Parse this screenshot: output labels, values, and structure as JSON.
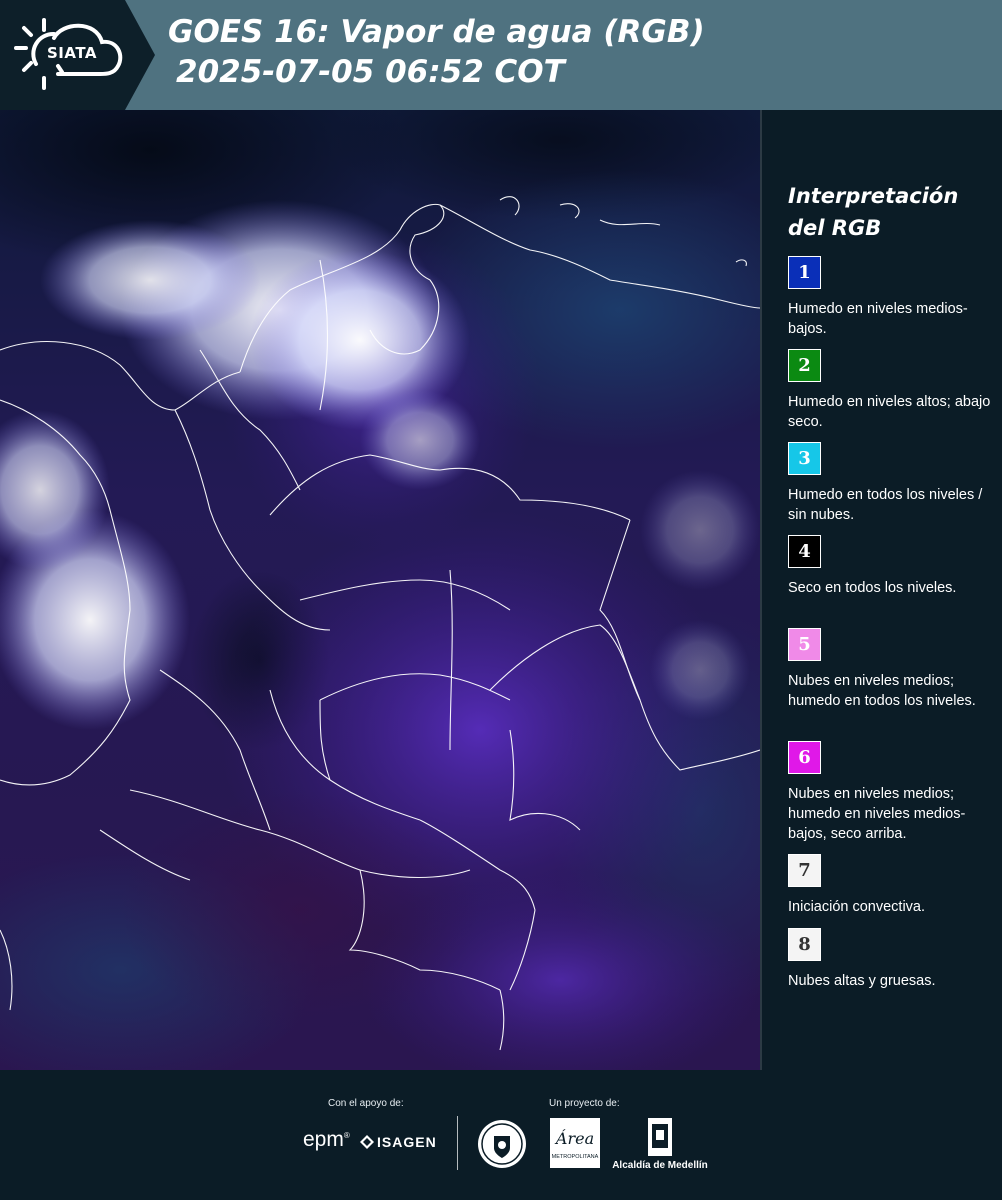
{
  "header": {
    "logo_text": "SIATA",
    "title_line1": "GOES 16: Vapor de agua (RGB)",
    "title_line2": "2025-07-05 06:52 COT"
  },
  "map": {
    "description_color": "#1a1640"
  },
  "legend": {
    "title": "Interpretación del RGB",
    "items": [
      {
        "number": "1",
        "color": "#0a2fb8",
        "text_color": "#ffffff",
        "description": "Humedo en niveles medios-bajos."
      },
      {
        "number": "2",
        "color": "#0b8a12",
        "text_color": "#ffffff",
        "description": "Humedo en niveles altos; abajo seco."
      },
      {
        "number": "3",
        "color": "#16c7e8",
        "text_color": "#ffffff",
        "description": "Humedo en todos los niveles / sin nubes."
      },
      {
        "number": "4",
        "color": "#000000",
        "text_color": "#ffffff",
        "description": "Seco en todos los niveles."
      },
      {
        "number": "5",
        "color": "#f08ae8",
        "text_color": "#ffffff",
        "description": "Nubes en niveles medios; humedo en todos los niveles."
      },
      {
        "number": "6",
        "color": "#e018e8",
        "text_color": "#ffffff",
        "description": "Nubes en niveles medios; humedo en niveles medios-bajos, seco arriba."
      },
      {
        "number": "7",
        "color": "#f4f4f4",
        "text_color": "#333333",
        "description": "Iniciación convectiva."
      },
      {
        "number": "8",
        "color": "#f4f4f4",
        "text_color": "#333333",
        "description": "Nubes altas y gruesas."
      }
    ]
  },
  "footer": {
    "support_label": "Con el apoyo de:",
    "project_label": "Un proyecto de:",
    "epm": "epm",
    "isagen": "ISAGEN",
    "amva": "Área",
    "amva_sub": "METROPOLITANA",
    "alcaldia": "Alcaldía de Medellín"
  }
}
